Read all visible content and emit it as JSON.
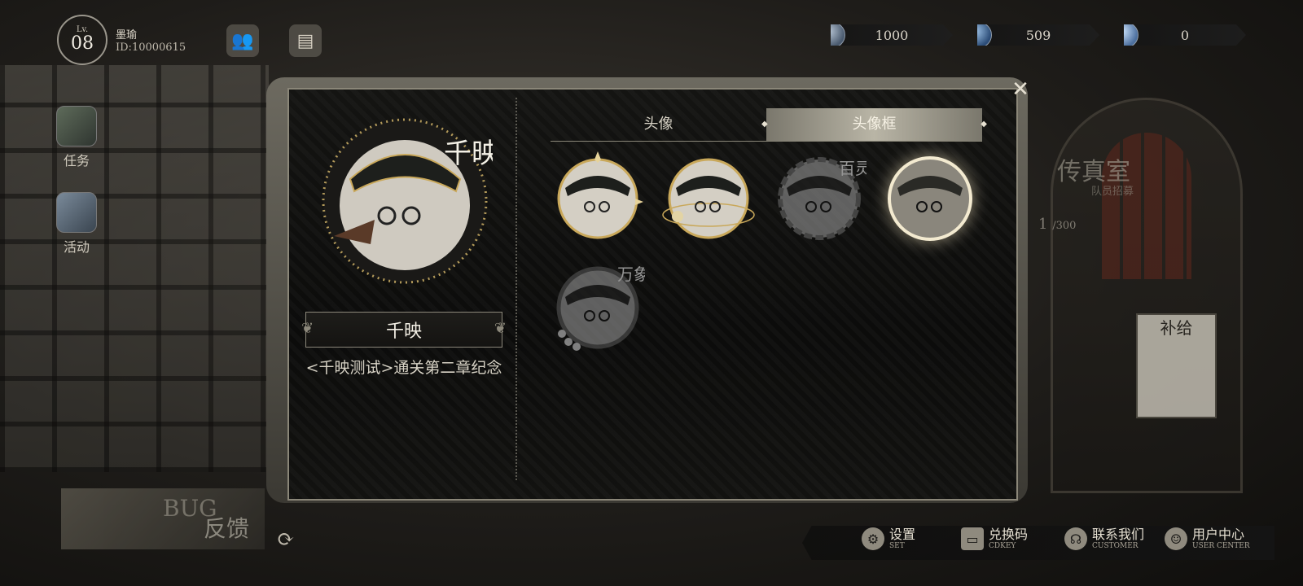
{
  "player": {
    "level_label": "Lv.",
    "level": "08",
    "name": "墨瑜",
    "uid": "ID:10000615"
  },
  "currencies": [
    {
      "icon": "silver-coin-icon",
      "value": "1000"
    },
    {
      "icon": "blue-gem-icon",
      "value": "509"
    },
    {
      "icon": "crystal-icon",
      "value": "0"
    }
  ],
  "side_menu": [
    {
      "label": "任务",
      "icon": "task-book-icon"
    },
    {
      "label": "活动",
      "icon": "event-icon"
    }
  ],
  "modal": {
    "tabs": [
      {
        "label": "头像",
        "active": false
      },
      {
        "label": "头像框",
        "active": true
      }
    ],
    "selected": {
      "name": "千映",
      "description": "<千映测试>通关第二章纪念"
    },
    "frames": [
      {
        "id": "frame-1",
        "style": "gold-star",
        "owned": true,
        "selected": false
      },
      {
        "id": "frame-2",
        "style": "gold-orbit",
        "owned": true,
        "selected": false
      },
      {
        "id": "frame-3",
        "style": "百灵",
        "owned": false,
        "selected": false
      },
      {
        "id": "frame-4",
        "style": "千映",
        "owned": true,
        "selected": true
      },
      {
        "id": "frame-5",
        "style": "万象",
        "owned": false,
        "selected": false
      }
    ]
  },
  "background": {
    "title": "传真室",
    "subtitle": "队员招募",
    "supply": "补给",
    "counter": "1",
    "counter_max": "/300"
  },
  "bug_feedback": {
    "bug": "BUG",
    "label": "反馈"
  },
  "bottom_menu": [
    {
      "label": "设置",
      "sub": "SET",
      "icon": "gear-icon"
    },
    {
      "label": "兑换码",
      "sub": "CDKEY",
      "icon": "ticket-icon"
    },
    {
      "label": "联系我们",
      "sub": "CUSTOMER",
      "icon": "headset-icon"
    },
    {
      "label": "用户中心",
      "sub": "USER CENTER",
      "icon": "user-icon"
    }
  ],
  "colors": {
    "accent_gold": "#d9c48a",
    "panel_bg": "#0f0f0e",
    "border": "#8a8678"
  }
}
